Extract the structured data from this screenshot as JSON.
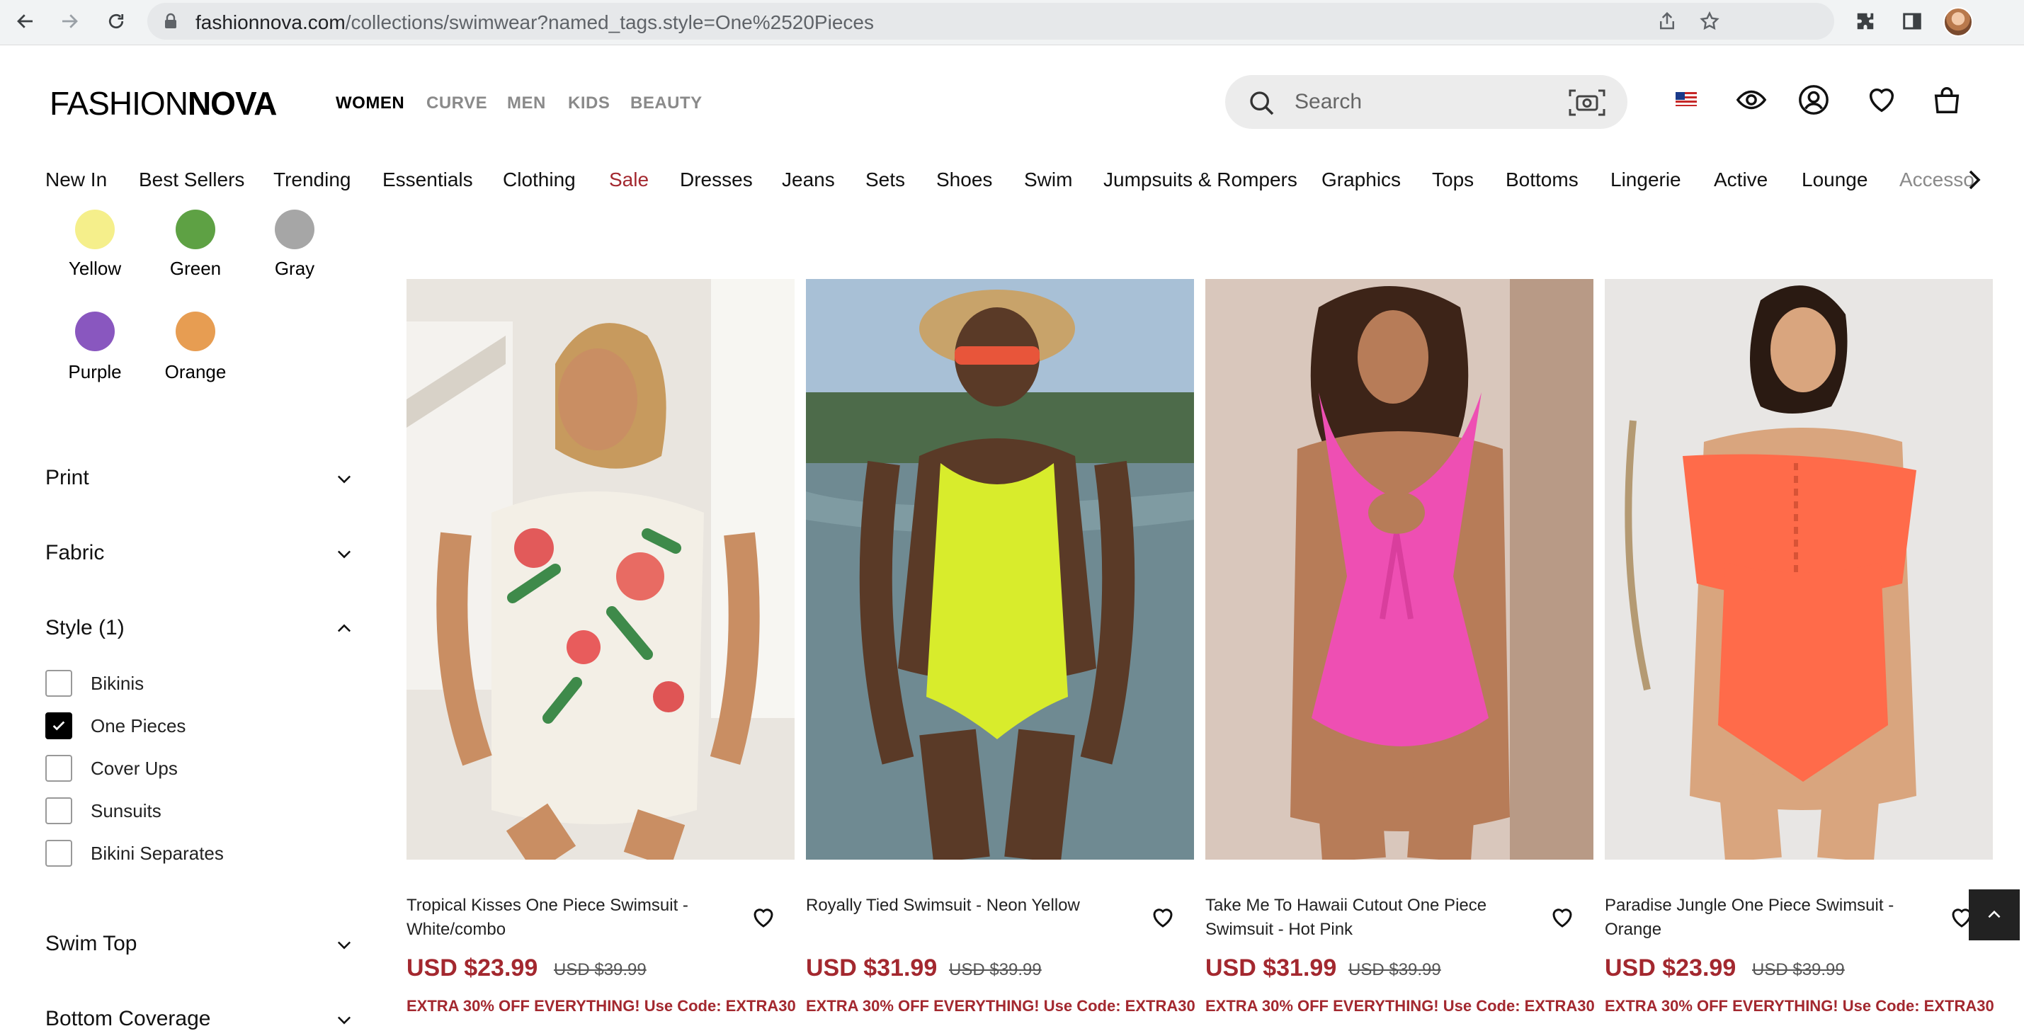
{
  "browser": {
    "url_host": "fashionnova.com",
    "url_path": "/collections/swimwear?named_tags.style=One%2520Pieces",
    "icons": [
      "back-icon",
      "forward-icon",
      "reload-icon",
      "lock-icon",
      "share-icon",
      "star-icon",
      "extensions-icon",
      "sidebar-icon",
      "profile-avatar"
    ]
  },
  "header": {
    "logo_light": "FASHION",
    "logo_bold": "NOVA",
    "departments": [
      "WOMEN",
      "CURVE",
      "MEN",
      "KIDS",
      "BEAUTY"
    ],
    "active_department": "WOMEN",
    "search_placeholder": "Search",
    "icons": [
      "flag-us-icon",
      "eye-icon",
      "account-icon",
      "heart-icon",
      "bag-icon"
    ]
  },
  "category_nav": [
    "New In",
    "Best Sellers",
    "Trending",
    "Essentials",
    "Clothing",
    "Sale",
    "Dresses",
    "Jeans",
    "Sets",
    "Shoes",
    "Swim",
    "Jumpsuits & Rompers",
    "Graphics",
    "Tops",
    "Bottoms",
    "Lingerie",
    "Active",
    "Lounge",
    "Accesso"
  ],
  "colors": {
    "swatches": [
      {
        "label": "Yellow",
        "hex": "#f5ef8b"
      },
      {
        "label": "Green",
        "hex": "#5ea144"
      },
      {
        "label": "Gray",
        "hex": "#a6a6a6"
      },
      {
        "label": "Purple",
        "hex": "#8957bf"
      },
      {
        "label": "Orange",
        "hex": "#e79d52"
      }
    ]
  },
  "filters": {
    "facets": [
      "Print",
      "Fabric",
      "Style (1)",
      "Swim Top",
      "Bottom Coverage"
    ],
    "style_options": [
      {
        "label": "Bikinis",
        "checked": false
      },
      {
        "label": "One Pieces",
        "checked": true
      },
      {
        "label": "Cover Ups",
        "checked": false
      },
      {
        "label": "Sunsuits",
        "checked": false
      },
      {
        "label": "Bikini Separates",
        "checked": false
      }
    ]
  },
  "products": [
    {
      "name": "Tropical Kisses One Piece Swimsuit - White/combo",
      "price": "USD $23.99",
      "compare": "USD $39.99",
      "promo": "EXTRA 30% OFF EVERYTHING! Use Code: EXTRA30"
    },
    {
      "name": "Royally Tied Swimsuit - Neon Yellow",
      "price": "USD $31.99",
      "compare": "USD $39.99",
      "promo": "EXTRA 30% OFF EVERYTHING! Use Code: EXTRA30"
    },
    {
      "name": "Take Me To Hawaii Cutout One Piece Swimsuit - Hot Pink",
      "price": "USD $31.99",
      "compare": "USD $39.99",
      "promo": "EXTRA 30% OFF EVERYTHING! Use Code: EXTRA30"
    },
    {
      "name": "Paradise Jungle One Piece Swimsuit - Orange",
      "price": "USD $23.99",
      "compare": "USD $39.99",
      "promo": "EXTRA 30% OFF EVERYTHING! Use Code: EXTRA30"
    }
  ],
  "brand_colors": {
    "sale_red": "#a3282f"
  }
}
